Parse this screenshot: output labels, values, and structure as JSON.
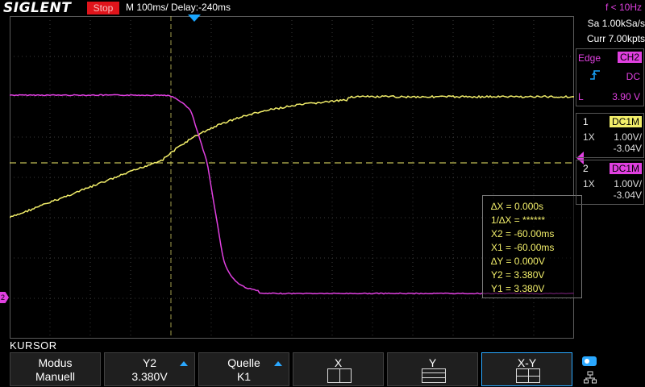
{
  "header": {
    "logo": "SIGLENT",
    "run_state": "Stop",
    "timebase": "M 100ms/  Delay:-240ms",
    "frequency": "f < 10Hz"
  },
  "acquisition": {
    "sample_rate": "Sa 1.00kSa/s",
    "memory": "Curr 7.00kpts"
  },
  "trigger": {
    "type": "Edge",
    "source": "CH2",
    "slope_icon": "rising-edge-icon",
    "coupling": "DC",
    "level_label": "L",
    "level": "3.90 V"
  },
  "channels": [
    {
      "number": "1",
      "coupling": "DC1M",
      "probe": "1X",
      "scale": "1.00V/",
      "offset": "-3.04V",
      "color": "#f2ee6a"
    },
    {
      "number": "2",
      "coupling": "DC1M",
      "probe": "1X",
      "scale": "1.00V/",
      "offset": "-3.04V",
      "color": "#e040e0"
    }
  ],
  "cursor_readout": {
    "dx": "∆X = 0.000s",
    "inv_dx": "1/∆X = ******",
    "x2": "X2 = -60.00ms",
    "x1": "X1 = -60.00ms",
    "dy": "∆Y = 0.000V",
    "y2": "Y2 = 3.380V",
    "y1": "Y1 = 3.380V"
  },
  "menu": {
    "title": "KURSOR",
    "keys": [
      {
        "label": "Modus",
        "value": "Manuell"
      },
      {
        "label": "Y2",
        "value": "3.380V"
      },
      {
        "label": "Quelle",
        "value": "K1"
      },
      {
        "label": "X",
        "value": ""
      },
      {
        "label": "Y",
        "value": ""
      },
      {
        "label": "X-Y",
        "value": ""
      }
    ]
  },
  "colors": {
    "ch1": "#f2ee6a",
    "ch2": "#e040e0",
    "accent": "#2aa8ff",
    "stop": "#e0141b"
  },
  "ch2_marker": "2"
}
